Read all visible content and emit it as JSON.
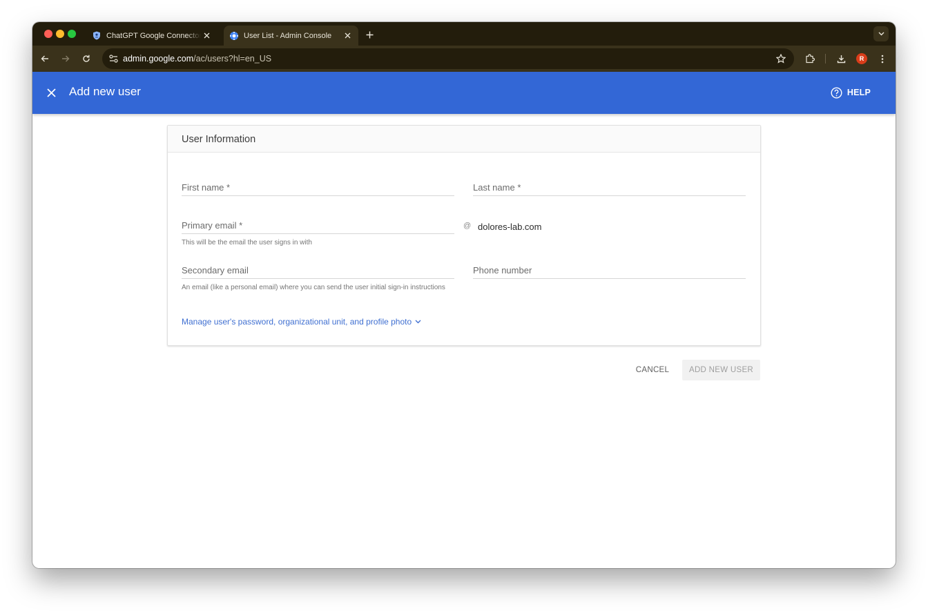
{
  "browser": {
    "tabs": [
      {
        "title": "ChatGPT Google Connector -",
        "favicon": "shield-icon",
        "active": false
      },
      {
        "title": "User List - Admin Console",
        "favicon": "admin-gear-icon",
        "active": true
      }
    ],
    "url_host": "admin.google.com",
    "url_path": "/ac/users?hl=en_US",
    "profile_initial": "R"
  },
  "header": {
    "title": "Add new user",
    "help_label": "HELP"
  },
  "card": {
    "title": "User Information",
    "first_name_label": "First name *",
    "last_name_label": "Last name *",
    "primary_email_label": "Primary email *",
    "at_sign": "@",
    "domain": "dolores-lab.com",
    "primary_email_helper": "This will be the email the user signs in with",
    "secondary_email_label": "Secondary email",
    "secondary_email_helper": "An email (like a personal email) where you can send the user initial sign-in instructions",
    "phone_label": "Phone number",
    "manage_link": "Manage user's password, organizational unit, and profile photo"
  },
  "actions": {
    "cancel_label": "CANCEL",
    "add_label": "ADD NEW USER"
  },
  "colors": {
    "app_bar": "#3367d6",
    "link": "#3f6fd1",
    "browser_frame": "#231d0c",
    "toolbar": "#3a321b"
  }
}
